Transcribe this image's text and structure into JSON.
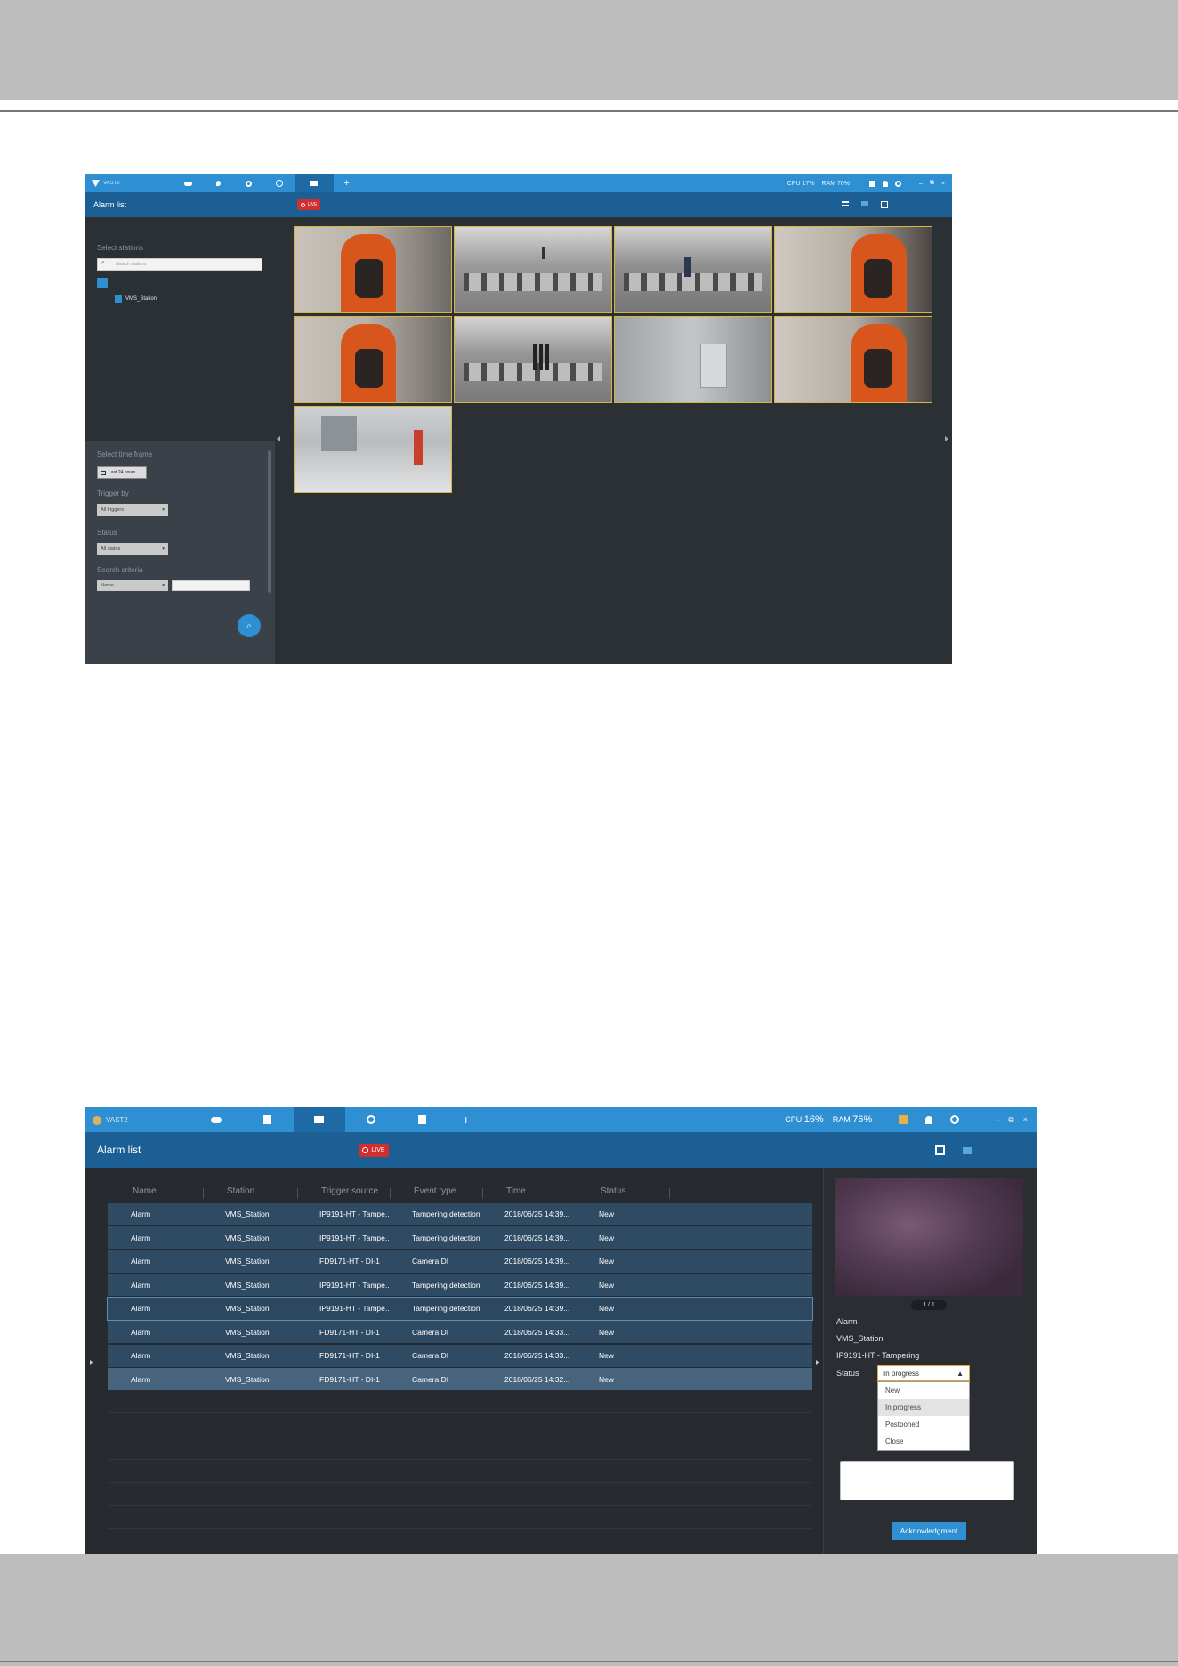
{
  "shot1": {
    "app_name": "VAST2",
    "header_title": "Alarm list",
    "live_label": "LIVE",
    "stat_cpu": "17%",
    "stat_ram": "70%",
    "select_stations_label": "Select stations",
    "search_placeholder": "Search stations",
    "station_name": "VMS_Station",
    "time_frame_label": "Select time frame",
    "time_frame_value": "Last 24 hours",
    "trigger_label": "Trigger by",
    "trigger_value": "All triggers",
    "status_label": "Status",
    "status_value": "All status",
    "criteria_label": "Search criteria",
    "criteria_value": "Name"
  },
  "shot2": {
    "app_name": "VAST2",
    "header_title": "Alarm list",
    "live_label": "LIVE",
    "stat_cpu": "16%",
    "stat_ram": "76%",
    "columns": [
      "Name",
      "Station",
      "Trigger source",
      "Event type",
      "Time",
      "Status"
    ],
    "rows": [
      [
        "Alarm",
        "VMS_Station",
        "IP9191-HT - Tampe...",
        "Tampering detection",
        "2018/06/25 14:39...",
        "New"
      ],
      [
        "Alarm",
        "VMS_Station",
        "IP9191-HT - Tampe...",
        "Tampering detection",
        "2018/06/25 14:39...",
        "New"
      ],
      [
        "Alarm",
        "VMS_Station",
        "FD9171-HT - DI-1",
        "Camera DI",
        "2018/06/25 14:39...",
        "New"
      ],
      [
        "Alarm",
        "VMS_Station",
        "IP9191-HT - Tampe...",
        "Tampering detection",
        "2018/06/25 14:39...",
        "New"
      ],
      [
        "Alarm",
        "VMS_Station",
        "IP9191-HT - Tampe...",
        "Tampering detection",
        "2018/06/25 14:39...",
        "New"
      ],
      [
        "Alarm",
        "VMS_Station",
        "FD9171-HT - DI-1",
        "Camera DI",
        "2018/06/25 14:33...",
        "New"
      ],
      [
        "Alarm",
        "VMS_Station",
        "FD9171-HT - DI-1",
        "Camera DI",
        "2018/06/25 14:33...",
        "New"
      ],
      [
        "Alarm",
        "VMS_Station",
        "FD9171-HT - DI-1",
        "Camera DI",
        "2018/06/25 14:32...",
        "New"
      ]
    ],
    "page_indicator": "1 / 1",
    "detail_name": "Alarm",
    "detail_station": "VMS_Station",
    "detail_source": "IP9191-HT - Tampering",
    "status_label": "Status",
    "status_value": "In progress",
    "status_options": [
      "New",
      "In progress",
      "Postponed",
      "Close"
    ],
    "ack_label": "Acknowledgment"
  },
  "colors": {
    "accent": "#2f8fd3",
    "header": "#1c5f94",
    "live": "#d12f2f",
    "tile_border": "#d9b440"
  }
}
